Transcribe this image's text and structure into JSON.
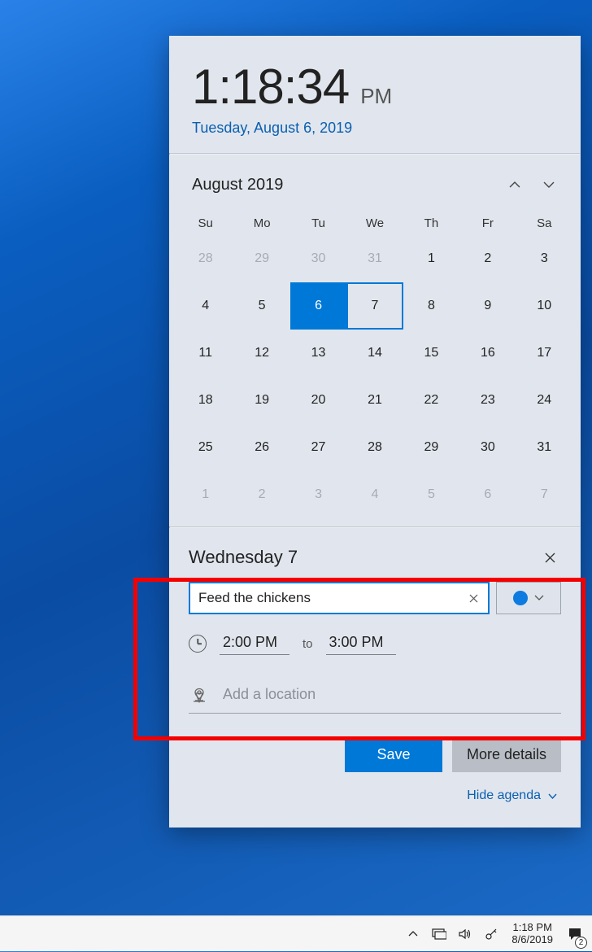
{
  "clock": {
    "time": "1:18:34",
    "ampm": "PM",
    "date": "Tuesday, August 6, 2019"
  },
  "calendar": {
    "month_label": "August 2019",
    "day_headers": [
      "Su",
      "Mo",
      "Tu",
      "We",
      "Th",
      "Fr",
      "Sa"
    ],
    "weeks": [
      [
        {
          "n": "28",
          "o": true
        },
        {
          "n": "29",
          "o": true
        },
        {
          "n": "30",
          "o": true
        },
        {
          "n": "31",
          "o": true
        },
        {
          "n": "1"
        },
        {
          "n": "2"
        },
        {
          "n": "3"
        }
      ],
      [
        {
          "n": "4"
        },
        {
          "n": "5"
        },
        {
          "n": "6",
          "today": true
        },
        {
          "n": "7",
          "selected": true
        },
        {
          "n": "8"
        },
        {
          "n": "9"
        },
        {
          "n": "10"
        }
      ],
      [
        {
          "n": "11"
        },
        {
          "n": "12"
        },
        {
          "n": "13"
        },
        {
          "n": "14"
        },
        {
          "n": "15"
        },
        {
          "n": "16"
        },
        {
          "n": "17"
        }
      ],
      [
        {
          "n": "18"
        },
        {
          "n": "19"
        },
        {
          "n": "20"
        },
        {
          "n": "21"
        },
        {
          "n": "22"
        },
        {
          "n": "23"
        },
        {
          "n": "24"
        }
      ],
      [
        {
          "n": "25"
        },
        {
          "n": "26"
        },
        {
          "n": "27"
        },
        {
          "n": "28"
        },
        {
          "n": "29"
        },
        {
          "n": "30"
        },
        {
          "n": "31"
        }
      ],
      [
        {
          "n": "1",
          "o": true
        },
        {
          "n": "2",
          "o": true
        },
        {
          "n": "3",
          "o": true
        },
        {
          "n": "4",
          "o": true
        },
        {
          "n": "5",
          "o": true
        },
        {
          "n": "6",
          "o": true
        },
        {
          "n": "7",
          "o": true
        }
      ]
    ]
  },
  "event": {
    "day_label": "Wednesday 7",
    "title_value": "Feed the chickens",
    "start_time": "2:00 PM",
    "to_label": "to",
    "end_time": "3:00 PM",
    "location_placeholder": "Add a location",
    "save_label": "Save",
    "more_label": "More details"
  },
  "hide_agenda_label": "Hide agenda",
  "taskbar": {
    "time": "1:18 PM",
    "date": "8/6/2019",
    "notif_count": "2"
  }
}
